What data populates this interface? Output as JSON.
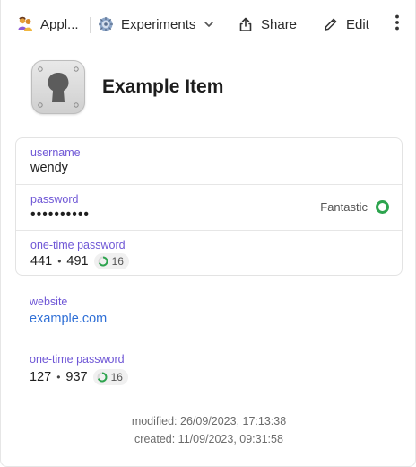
{
  "toolbar": {
    "account_label": "Appl...",
    "account_icon": "people-icon",
    "vault_label": "Experiments",
    "vault_icon": "vault-icon",
    "share_label": "Share",
    "edit_label": "Edit",
    "more_icon": "kebab-icon"
  },
  "item": {
    "title": "Example Item",
    "icon": "keyhole-lock-icon"
  },
  "fields": {
    "username": {
      "label": "username",
      "value": "wendy"
    },
    "password": {
      "label": "password",
      "value": "••••••••••",
      "strength": "Fantastic",
      "strength_color": "#2da44e"
    },
    "otp1": {
      "label": "one-time password",
      "part1": "441",
      "part2": "491",
      "separator": "•",
      "seconds": "16"
    }
  },
  "website": {
    "label": "website",
    "value": "example.com",
    "link_color": "#2f6fd6"
  },
  "otp2": {
    "label": "one-time password",
    "part1": "127",
    "part2": "937",
    "separator": "•",
    "seconds": "16"
  },
  "meta": {
    "modified": "modified: 26/09/2023, 17:13:38",
    "created": "created: 11/09/2023, 09:31:58"
  },
  "colors": {
    "label_purple": "#6f57d6",
    "timer_green": "#2da44e"
  }
}
